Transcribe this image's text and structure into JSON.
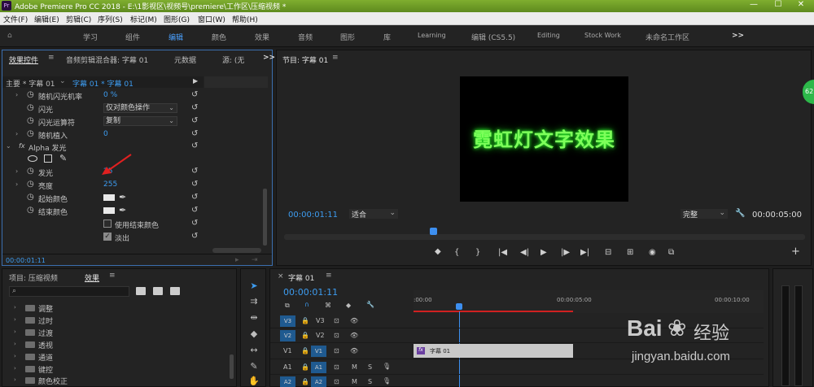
{
  "app": {
    "title": "Adobe Premiere Pro CC 2018 - E:\\1影视区\\视频号\\premiere\\工作区\\压缩视频 *",
    "logo": "Pr"
  },
  "menu": [
    "文件(F)",
    "编辑(E)",
    "剪辑(C)",
    "序列(S)",
    "标记(M)",
    "图形(G)",
    "窗口(W)",
    "帮助(H)"
  ],
  "workspaces": [
    {
      "label": "学习",
      "active": false
    },
    {
      "label": "组件",
      "active": false
    },
    {
      "label": "编辑",
      "active": true
    },
    {
      "label": "颜色",
      "active": false
    },
    {
      "label": "效果",
      "active": false
    },
    {
      "label": "音频",
      "active": false
    },
    {
      "label": "图形",
      "active": false
    },
    {
      "label": "库",
      "active": false
    },
    {
      "label": "Learning",
      "active": false
    },
    {
      "label": "编辑 (CS5.5)",
      "active": false
    },
    {
      "label": "Editing",
      "active": false
    },
    {
      "label": "Stock Work",
      "active": false
    },
    {
      "label": "未命名工作区",
      "active": false
    },
    {
      "label": ">>",
      "active": false
    }
  ],
  "effect_controls": {
    "tabs": [
      "效果控件",
      "音频剪辑混合器: 字幕 01",
      "元数据",
      "源: (无"
    ],
    "tab_more": ">>",
    "master": "主要 * 字幕 01",
    "sequence": "字幕 01 * 字幕 01",
    "rows": {
      "rand_flash_rate": {
        "label": "随机闪光机率",
        "value": "0 %"
      },
      "flash": {
        "label": "闪光",
        "value": "仅对颜色操作"
      },
      "flash_op": {
        "label": "闪光运算符",
        "value": "复制"
      },
      "rand_seed": {
        "label": "随机植入",
        "value": "0"
      },
      "alpha_glow": {
        "label": "Alpha 发光",
        "fx": "fx"
      },
      "glow": {
        "label": "发光",
        "value": "25"
      },
      "brightness": {
        "label": "亮度",
        "value": "255"
      },
      "start_color": {
        "label": "起始颜色"
      },
      "end_color": {
        "label": "结束颜色"
      },
      "use_end_color": {
        "label": "使用结束颜色",
        "checked": false
      },
      "fade_out": {
        "label": "淡出",
        "checked": true
      }
    },
    "timecode": "00:00:01:11",
    "reset_glyph": "↺"
  },
  "program": {
    "title": "节目: 字幕 01",
    "preview_text": "霓虹灯文字效果",
    "timecode": "00:00:01:11",
    "fit": "适合",
    "quality": "完整",
    "duration": "00:00:05:00",
    "preview_color": "#7dff5a"
  },
  "project": {
    "tabs": [
      "项目: 压缩视频",
      "效果"
    ],
    "tree": [
      "调整",
      "过时",
      "过渡",
      "透视",
      "通道",
      "键控",
      "颜色校正"
    ]
  },
  "timeline": {
    "title": "字幕 01",
    "timecode": "00:00:01:11",
    "ruler": [
      ":00:00",
      "00:00:05:00",
      "00:00:10:00"
    ],
    "tracks": [
      {
        "name": "V3",
        "label": "V3"
      },
      {
        "name": "V2",
        "label": "V2"
      },
      {
        "name": "V1",
        "label": "V1",
        "src": "V1"
      },
      {
        "name": "A1",
        "label": "A1",
        "src": "A1"
      },
      {
        "name": "A2",
        "label": "A2",
        "src": "A2"
      }
    ],
    "clip": {
      "label": "字幕 01",
      "fx": "fx"
    }
  },
  "side_badge": "62",
  "watermark": {
    "brand": "Bai",
    "brand_cn": "经验",
    "url": "jingyan.baidu.com"
  }
}
